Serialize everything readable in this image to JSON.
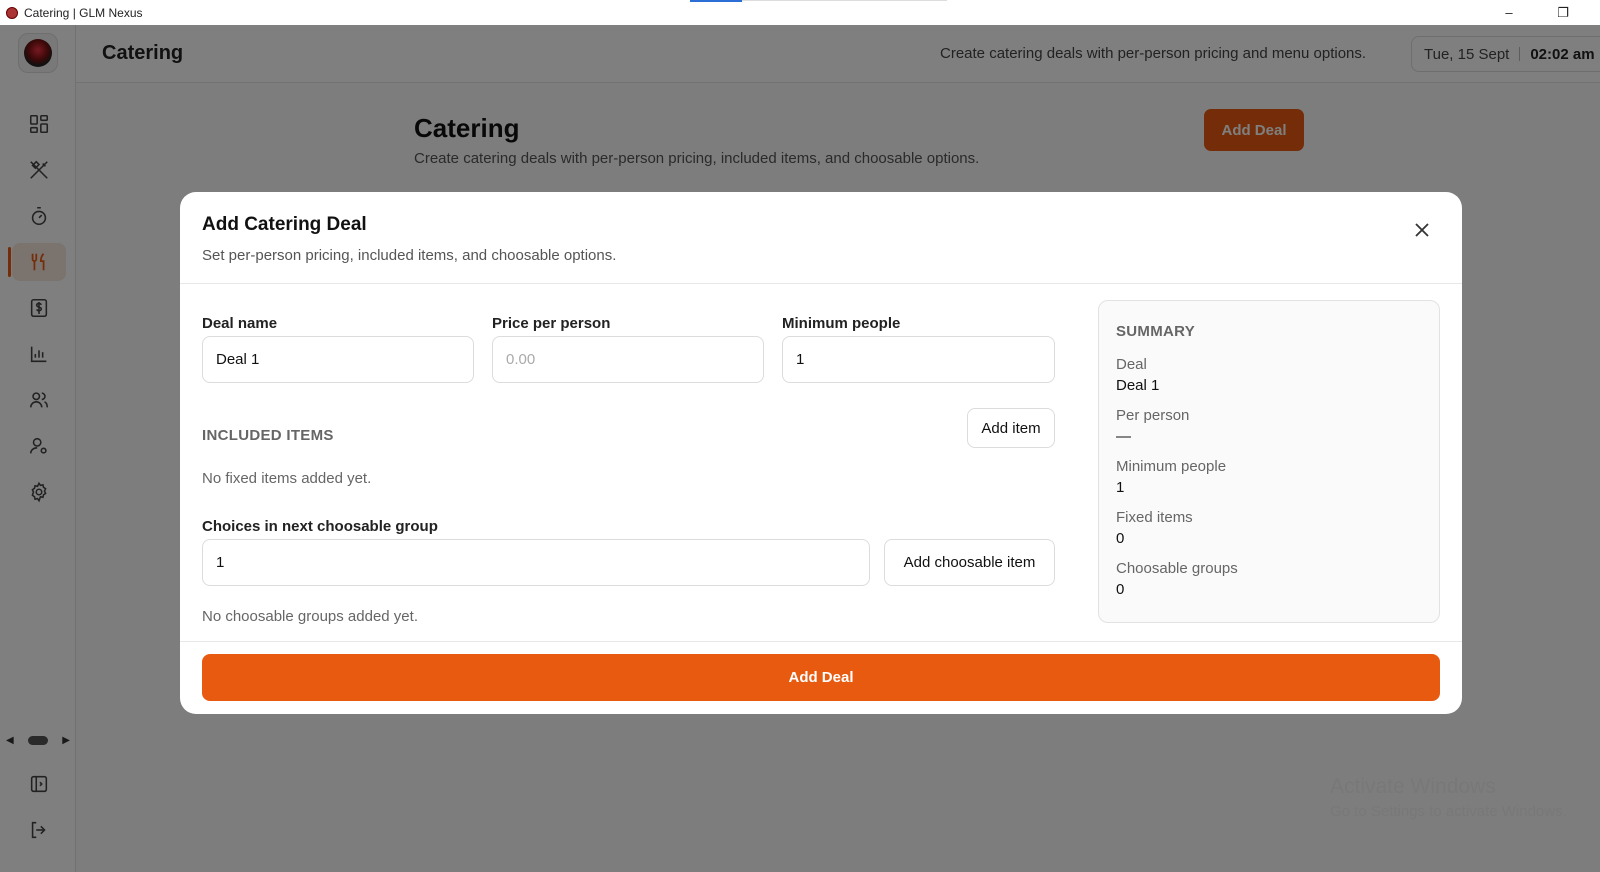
{
  "window": {
    "title": "Catering | GLM Nexus",
    "minimize": "–",
    "maximize": "❐"
  },
  "header": {
    "title": "Catering",
    "subtitle": "Create catering deals with per-person pricing and menu options.",
    "date": "Tue, 15 Sept",
    "time": "02:02 am"
  },
  "sidebar": {
    "items": [
      {
        "icon": "dashboard-icon"
      },
      {
        "icon": "utensils-cross-icon"
      },
      {
        "icon": "timer-icon"
      },
      {
        "icon": "fork-knife-icon",
        "active": true
      },
      {
        "icon": "dollar-receipt-icon"
      },
      {
        "icon": "bar-chart-icon"
      },
      {
        "icon": "users-icon"
      },
      {
        "icon": "user-settings-icon"
      },
      {
        "icon": "gear-icon"
      }
    ],
    "bottom": [
      {
        "icon": "panel-toggle-icon"
      },
      {
        "icon": "logout-icon"
      }
    ]
  },
  "page": {
    "title": "Catering",
    "description": "Create catering deals with per-person pricing, included items, and choosable options.",
    "add_deal_label": "Add Deal"
  },
  "modal": {
    "title": "Add Catering Deal",
    "description": "Set per-person pricing, included items, and choosable options.",
    "fields": {
      "deal_name": {
        "label": "Deal name",
        "value": "Deal 1"
      },
      "price_per_person": {
        "label": "Price per person",
        "placeholder": "0.00",
        "value": ""
      },
      "minimum_people": {
        "label": "Minimum people",
        "value": "1"
      }
    },
    "included_items": {
      "label": "INCLUDED ITEMS",
      "add_label": "Add item",
      "empty": "No fixed items added yet."
    },
    "choosable": {
      "label": "Choices in next choosable group",
      "value": "1",
      "add_label": "Add choosable item",
      "empty": "No choosable groups added yet."
    },
    "summary": {
      "title": "SUMMARY",
      "rows": [
        {
          "label": "Deal",
          "value": "Deal 1"
        },
        {
          "label": "Per person",
          "value": "—"
        },
        {
          "label": "Minimum people",
          "value": "1"
        },
        {
          "label": "Fixed items",
          "value": "0"
        },
        {
          "label": "Choosable groups",
          "value": "0"
        }
      ]
    },
    "submit_label": "Add Deal"
  },
  "watermark": {
    "line1": "Activate Windows",
    "line2": "Go to Settings to activate Windows."
  },
  "colors": {
    "accent": "#e85a10",
    "overlay": "rgba(0,0,0,0.5)"
  }
}
